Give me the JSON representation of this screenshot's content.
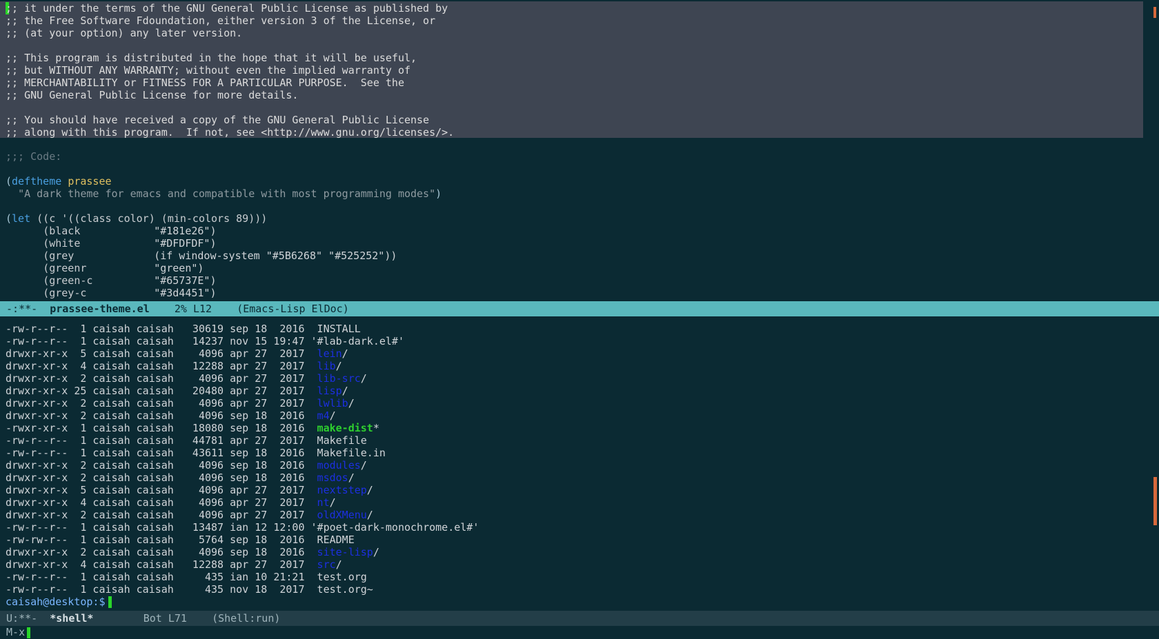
{
  "editor": {
    "license_lines": [
      ";; it under the terms of the GNU General Public License as published by",
      ";; the Free Software Fdoundation, either version 3 of the License, or",
      ";; (at your option) any later version.",
      "",
      ";; This program is distributed in the hope that it will be useful,",
      ";; but WITHOUT ANY WARRANTY; without even the implied warranty of",
      ";; MERCHANTABILITY or FITNESS FOR A PARTICULAR PURPOSE.  See the",
      ";; GNU General Public License for more details.",
      "",
      ";; You should have received a copy of the GNU General Public License",
      ";; along with this program.  If not, see <http://www.gnu.org/licenses/>."
    ],
    "code_comment": ";;; Code:",
    "deftheme": {
      "keyword": "deftheme",
      "name": "prassee",
      "docstring": "\"A dark theme for emacs and compatible with most programming modes\""
    },
    "let_line": {
      "keyword": "let",
      "rest": "((c '((class color) (min-colors 89)))"
    },
    "color_defs": [
      {
        "name": "(black",
        "value": "\"#181e26\")"
      },
      {
        "name": "(white",
        "value": "\"#DFDFDF\")"
      },
      {
        "name": "(grey",
        "value": "(if window-system \"#5B6268\" \"#525252\"))"
      },
      {
        "name": "(greenr",
        "value": "\"green\")"
      },
      {
        "name": "(green-c",
        "value": "\"#65737E\")"
      },
      {
        "name": "(grey-c",
        "value": "\"#3d4451\")"
      }
    ]
  },
  "modeline_top": {
    "status": "-:**-",
    "buffer": "prassee-theme.el",
    "position": "2% L12",
    "modes": "(Emacs-Lisp ElDoc)"
  },
  "shell": {
    "rows": [
      {
        "meta": "-rw-r--r--  1 caisah caisah   30619 sep 18  2016  ",
        "name": "INSTALL",
        "suffix": "",
        "kind": "plain"
      },
      {
        "meta": "-rw-r--r--  1 caisah caisah   14237 nov 15 19:47 ",
        "name": "'#lab-dark.el#'",
        "suffix": "",
        "kind": "plain"
      },
      {
        "meta": "drwxr-xr-x  5 caisah caisah    4096 apr 27  2017  ",
        "name": "lein",
        "suffix": "/",
        "kind": "dir"
      },
      {
        "meta": "drwxr-xr-x  4 caisah caisah   12288 apr 27  2017  ",
        "name": "lib",
        "suffix": "/",
        "kind": "dir"
      },
      {
        "meta": "drwxr-xr-x  2 caisah caisah    4096 apr 27  2017  ",
        "name": "lib-src",
        "suffix": "/",
        "kind": "dir"
      },
      {
        "meta": "drwxr-xr-x 25 caisah caisah   20480 apr 27  2017  ",
        "name": "lisp",
        "suffix": "/",
        "kind": "dir"
      },
      {
        "meta": "drwxr-xr-x  2 caisah caisah    4096 apr 27  2017  ",
        "name": "lwlib",
        "suffix": "/",
        "kind": "dir"
      },
      {
        "meta": "drwxr-xr-x  2 caisah caisah    4096 sep 18  2016  ",
        "name": "m4",
        "suffix": "/",
        "kind": "dir"
      },
      {
        "meta": "-rwxr-xr-x  1 caisah caisah   18080 sep 18  2016  ",
        "name": "make-dist",
        "suffix": "*",
        "kind": "exec"
      },
      {
        "meta": "-rw-r--r--  1 caisah caisah   44781 apr 27  2017  ",
        "name": "Makefile",
        "suffix": "",
        "kind": "plain"
      },
      {
        "meta": "-rw-r--r--  1 caisah caisah   43611 sep 18  2016  ",
        "name": "Makefile.in",
        "suffix": "",
        "kind": "plain"
      },
      {
        "meta": "drwxr-xr-x  2 caisah caisah    4096 sep 18  2016  ",
        "name": "modules",
        "suffix": "/",
        "kind": "dir"
      },
      {
        "meta": "drwxr-xr-x  2 caisah caisah    4096 sep 18  2016  ",
        "name": "msdos",
        "suffix": "/",
        "kind": "dir"
      },
      {
        "meta": "drwxr-xr-x  5 caisah caisah    4096 apr 27  2017  ",
        "name": "nextstep",
        "suffix": "/",
        "kind": "dir"
      },
      {
        "meta": "drwxr-xr-x  4 caisah caisah    4096 apr 27  2017  ",
        "name": "nt",
        "suffix": "/",
        "kind": "dir"
      },
      {
        "meta": "drwxr-xr-x  2 caisah caisah    4096 apr 27  2017  ",
        "name": "oldXMenu",
        "suffix": "/",
        "kind": "dir"
      },
      {
        "meta": "-rw-r--r--  1 caisah caisah   13487 ian 12 12:00 ",
        "name": "'#poet-dark-monochrome.el#'",
        "suffix": "",
        "kind": "plain"
      },
      {
        "meta": "-rw-rw-r--  1 caisah caisah    5764 sep 18  2016  ",
        "name": "README",
        "suffix": "",
        "kind": "plain"
      },
      {
        "meta": "drwxr-xr-x  2 caisah caisah    4096 sep 18  2016  ",
        "name": "site-lisp",
        "suffix": "/",
        "kind": "dir"
      },
      {
        "meta": "drwxr-xr-x  4 caisah caisah   12288 apr 27  2017  ",
        "name": "src",
        "suffix": "/",
        "kind": "dir"
      },
      {
        "meta": "-rw-r--r--  1 caisah caisah     435 ian 10 21:21  ",
        "name": "test.org",
        "suffix": "",
        "kind": "plain"
      },
      {
        "meta": "-rw-r--r--  1 caisah caisah     435 nov 18  2017  ",
        "name": "test.org~",
        "suffix": "",
        "kind": "plain"
      }
    ],
    "prompt": "caisah@desktop:$"
  },
  "modeline_bottom": {
    "status": "U:**-",
    "buffer": "*shell*",
    "position": "Bot L71",
    "modes": "(Shell:run)"
  },
  "minibuffer": {
    "text": "M-x"
  }
}
